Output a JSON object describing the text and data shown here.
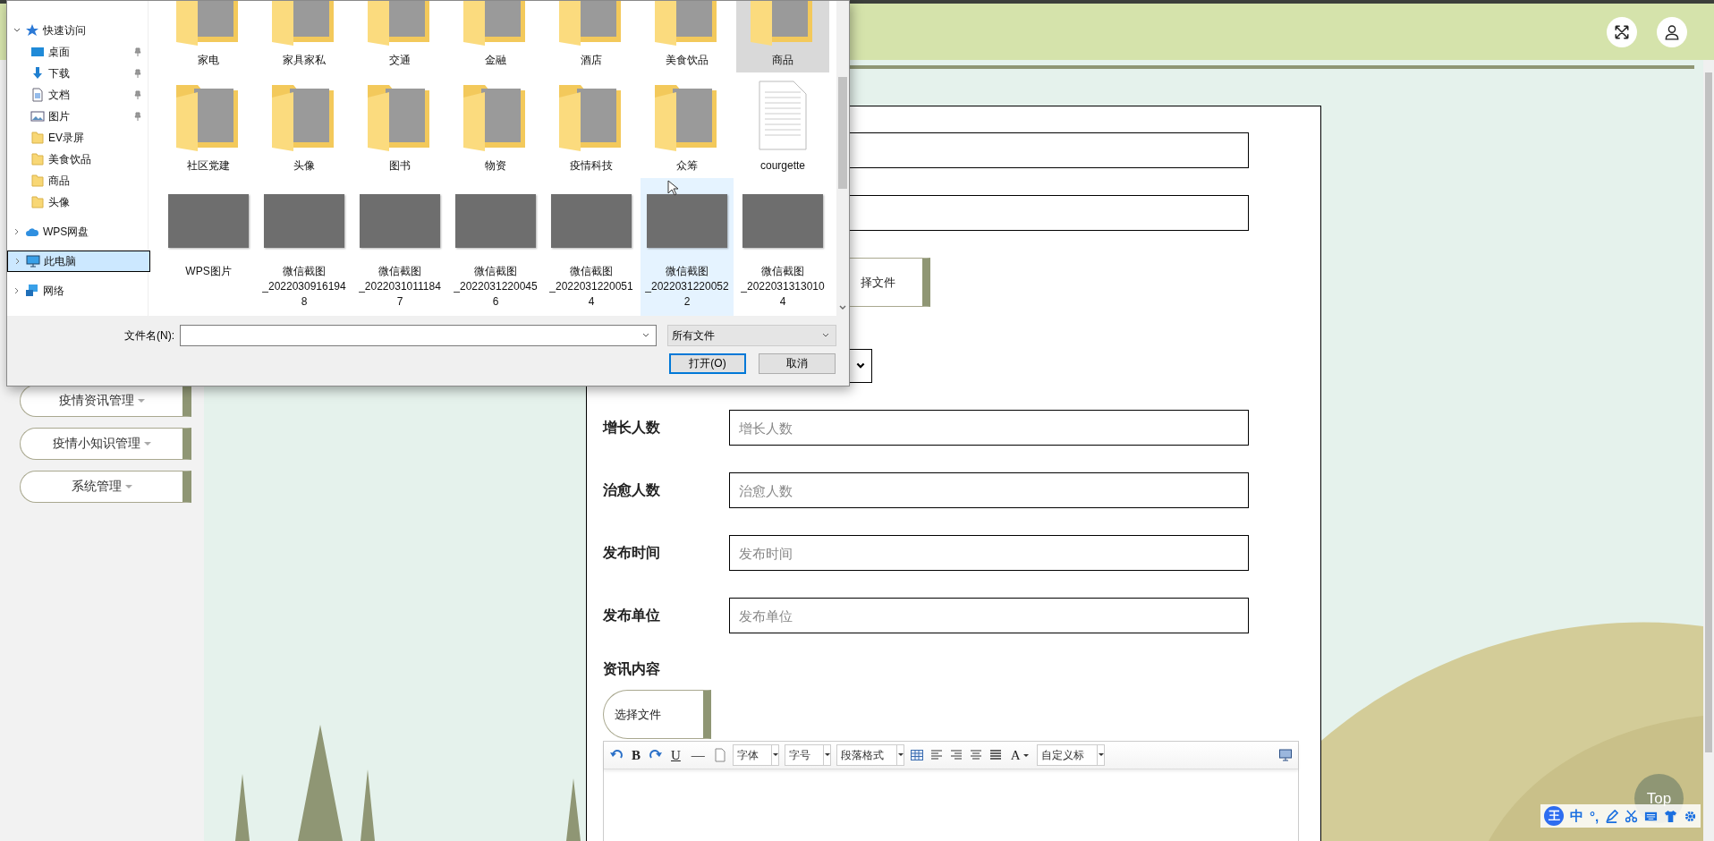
{
  "sidebar": {
    "items": [
      {
        "label": "疫情资讯管理"
      },
      {
        "label": "疫情小知识管理"
      },
      {
        "label": "系统管理"
      }
    ]
  },
  "form": {
    "fields": [
      {
        "kind": "text"
      },
      {
        "kind": "text"
      },
      {
        "kind": "file",
        "button": "择文件"
      },
      {
        "kind": "select"
      },
      {
        "kind": "text",
        "label": "增长人数",
        "placeholder": "增长人数"
      },
      {
        "kind": "text",
        "label": "治愈人数",
        "placeholder": "治愈人数"
      },
      {
        "kind": "text",
        "label": "发布时间",
        "placeholder": "发布时间"
      },
      {
        "kind": "text",
        "label": "发布单位",
        "placeholder": "发布单位"
      },
      {
        "kind": "editor",
        "label": "资讯内容",
        "button": "选择文件"
      }
    ]
  },
  "editor_toolbar": {
    "items": [
      {
        "kind": "undo"
      },
      {
        "kind": "bold",
        "text": "B"
      },
      {
        "kind": "redo"
      },
      {
        "kind": "underline",
        "text": "U"
      },
      {
        "kind": "rule",
        "text": "—"
      },
      {
        "kind": "page"
      },
      {
        "kind": "dropdown",
        "text": "字体"
      },
      {
        "kind": "dropdown",
        "text": "字号"
      },
      {
        "kind": "dropdown",
        "text": "段落格式"
      },
      {
        "kind": "table"
      },
      {
        "kind": "align_left"
      },
      {
        "kind": "align_right"
      },
      {
        "kind": "align_center"
      },
      {
        "kind": "align_justify"
      },
      {
        "kind": "color",
        "text": "A"
      },
      {
        "kind": "dropdown",
        "text": "自定义标"
      }
    ]
  },
  "top_button": "Top",
  "ime_toolbar": {
    "badge": "王",
    "items": [
      {
        "kind": "text",
        "text": "中"
      },
      {
        "kind": "text",
        "text": "°,"
      },
      {
        "kind": "pen"
      },
      {
        "kind": "scissors"
      },
      {
        "kind": "keyboard"
      },
      {
        "kind": "shirt"
      },
      {
        "kind": "gear"
      }
    ]
  },
  "dialog": {
    "nav": [
      {
        "label": "快速访问",
        "kind": "star",
        "expanded": true,
        "selected": false,
        "children": [
          {
            "label": "桌面",
            "kind": "desktop",
            "pinned": true,
            "selected": false
          },
          {
            "label": "下载",
            "kind": "download",
            "pinned": true,
            "selected": false
          },
          {
            "label": "文档",
            "kind": "document",
            "pinned": true,
            "selected": false
          },
          {
            "label": "图片",
            "kind": "picture",
            "pinned": true,
            "selected": false
          },
          {
            "label": "EV录屏",
            "kind": "folder",
            "pinned": false,
            "selected": false
          },
          {
            "label": "美食饮品",
            "kind": "folder",
            "pinned": false,
            "selected": false
          },
          {
            "label": "商品",
            "kind": "folder",
            "pinned": false,
            "selected": false
          },
          {
            "label": "头像",
            "kind": "folder",
            "pinned": false,
            "selected": false
          }
        ]
      },
      {
        "label": "WPS网盘",
        "kind": "cloud",
        "expanded": false,
        "selected": false
      },
      {
        "label": "此电脑",
        "kind": "computer",
        "expanded": false,
        "selected": true
      },
      {
        "label": "网络",
        "kind": "network",
        "expanded": false,
        "selected": false
      }
    ],
    "files": [
      {
        "name": "家电",
        "kind": "folder",
        "selected": false,
        "hovered": false
      },
      {
        "name": "家具家私",
        "kind": "folder",
        "selected": false,
        "hovered": false
      },
      {
        "name": "交通",
        "kind": "folder",
        "selected": false,
        "hovered": false
      },
      {
        "name": "金融",
        "kind": "folder",
        "selected": false,
        "hovered": false
      },
      {
        "name": "酒店",
        "kind": "folder",
        "selected": false,
        "hovered": false
      },
      {
        "name": "美食饮品",
        "kind": "folder",
        "selected": false,
        "hovered": false
      },
      {
        "name": "商品",
        "kind": "folder",
        "selected": true,
        "hovered": false
      },
      {
        "name": "社区党建",
        "kind": "folder",
        "selected": false,
        "hovered": false
      },
      {
        "name": "头像",
        "kind": "folder",
        "selected": false,
        "hovered": false
      },
      {
        "name": "图书",
        "kind": "folder",
        "selected": false,
        "hovered": false
      },
      {
        "name": "物资",
        "kind": "folder",
        "selected": false,
        "hovered": false
      },
      {
        "name": "疫情科技",
        "kind": "folder",
        "selected": false,
        "hovered": false
      },
      {
        "name": "众筹",
        "kind": "folder",
        "selected": false,
        "hovered": false
      },
      {
        "name": "courgette",
        "kind": "document",
        "selected": false,
        "hovered": false
      },
      {
        "name": "WPS图片",
        "kind": "image",
        "selected": false,
        "hovered": false
      },
      {
        "name": "微信截图_20220309161948",
        "kind": "image",
        "selected": false,
        "hovered": false
      },
      {
        "name": "微信截图_20220310111847",
        "kind": "image",
        "selected": false,
        "hovered": false
      },
      {
        "name": "微信截图_20220312200456",
        "kind": "image",
        "selected": false,
        "hovered": false
      },
      {
        "name": "微信截图_20220312200514",
        "kind": "image",
        "selected": false,
        "hovered": false
      },
      {
        "name": "微信截图_20220312200522",
        "kind": "image",
        "selected": false,
        "hovered": true
      },
      {
        "name": "微信截图_20220313130104",
        "kind": "image",
        "selected": false,
        "hovered": false
      }
    ],
    "filename_label": "文件名(N):",
    "filter": "所有文件",
    "buttons": [
      {
        "label": "打开(O)",
        "default": true
      },
      {
        "label": "取消",
        "default": false
      }
    ]
  }
}
